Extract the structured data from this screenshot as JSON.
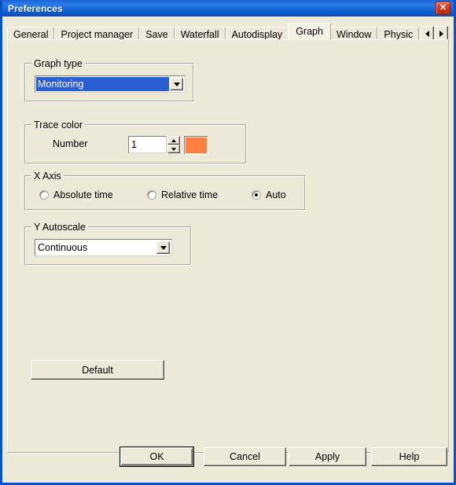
{
  "window": {
    "title": "Preferences",
    "close_icon": "close-icon",
    "close_glyph": "✕"
  },
  "tabs": {
    "items": [
      {
        "label": "General",
        "selected": false
      },
      {
        "label": "Project manager",
        "selected": false
      },
      {
        "label": "Save",
        "selected": false
      },
      {
        "label": "Waterfall",
        "selected": false
      },
      {
        "label": "Autodisplay",
        "selected": false
      },
      {
        "label": "Graph",
        "selected": true
      },
      {
        "label": "Window",
        "selected": false
      },
      {
        "label": "Physic",
        "selected": false
      }
    ],
    "scroll_left_icon": "triangle-left-icon",
    "scroll_right_icon": "triangle-right-icon"
  },
  "graph_type": {
    "group_label": "Graph type",
    "value": "Monitoring",
    "dropdown_icon": "chevron-down-icon"
  },
  "trace_color": {
    "group_label": "Trace color",
    "number_label": "Number",
    "number_value": "1",
    "spinner_up_icon": "triangle-up-icon",
    "spinner_down_icon": "triangle-down-icon",
    "swatch_color": "#ff7f40"
  },
  "x_axis": {
    "group_label": "X Axis",
    "options": [
      {
        "label": "Absolute time",
        "selected": false
      },
      {
        "label": "Relative time",
        "selected": false
      },
      {
        "label": "Auto",
        "selected": true
      }
    ]
  },
  "y_autoscale": {
    "group_label": "Y Autoscale",
    "value": "Continuous",
    "dropdown_icon": "chevron-down-icon"
  },
  "actions": {
    "default_label": "Default",
    "ok_label": "OK",
    "cancel_label": "Cancel",
    "apply_label": "Apply",
    "help_label": "Help"
  }
}
